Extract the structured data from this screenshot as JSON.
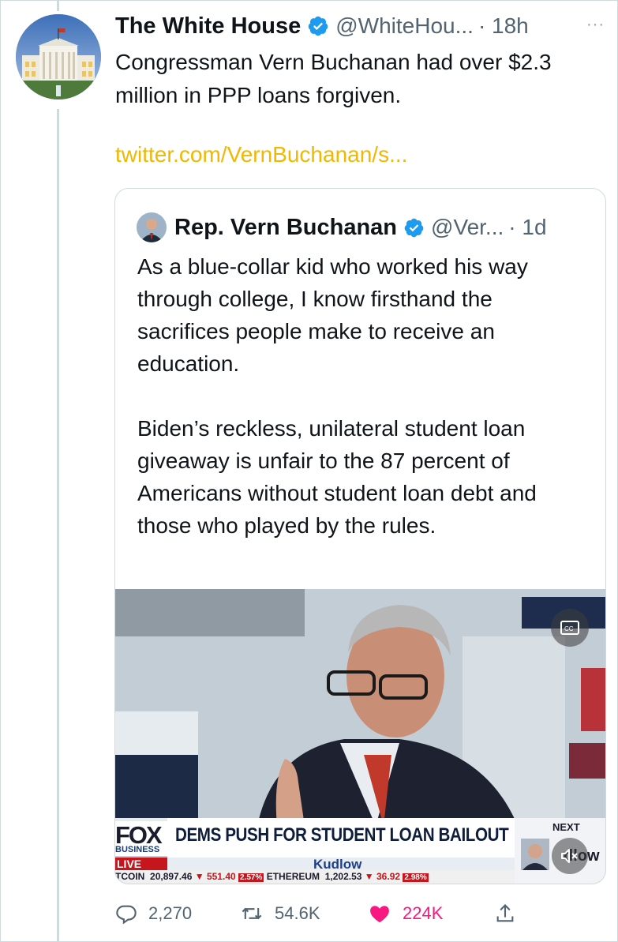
{
  "tweet": {
    "author_name": "The White House",
    "handle": "@WhiteHou...",
    "time": "· 18h",
    "more_label": "···",
    "text": "Congressman Vern Buchanan had over $2.3 million in PPP loans forgiven.",
    "link": "twitter.com/VernBuchanan/s..."
  },
  "quote": {
    "author_name": "Rep. Vern Buchanan",
    "handle": "@Ver...",
    "time": "· 1d",
    "text": "As a blue-collar kid who worked his way through college, I know firsthand the sacrifices people make to receive an education.\n\nBiden’s reckless, unilateral student loan giveaway is unfair to the 87 percent of Americans without student loan debt and those who played by the rules.",
    "video": {
      "network_logo": "FOX",
      "network_sub": "BUSINESS",
      "live_label": "LIVE",
      "headline": "DEMS PUSH FOR STUDENT LOAN BAILOUT",
      "show_name": "Kudlow",
      "ticker_1_name": "TCOIN",
      "ticker_1_value": "20,897.46",
      "ticker_1_change": "▼ 551.40",
      "ticker_1_pct": "2.57%",
      "ticker_2_name": "ETHEREUM",
      "ticker_2_value": "1,202.53",
      "ticker_2_change": "▼ 36.92",
      "ticker_2_pct": "2.98%",
      "next_label": "NEXT",
      "next_show": "dlow"
    }
  },
  "actions": {
    "replies": "2,270",
    "retweets": "54.6K",
    "likes": "224K"
  },
  "colors": {
    "verified": "#1d9bf0",
    "link": "#f0b800",
    "like": "#f91880"
  },
  "icons": [
    "verified-badge-icon",
    "more-icon",
    "cc-icon",
    "mute-icon",
    "reply-icon",
    "retweet-icon",
    "heart-icon",
    "share-icon"
  ]
}
